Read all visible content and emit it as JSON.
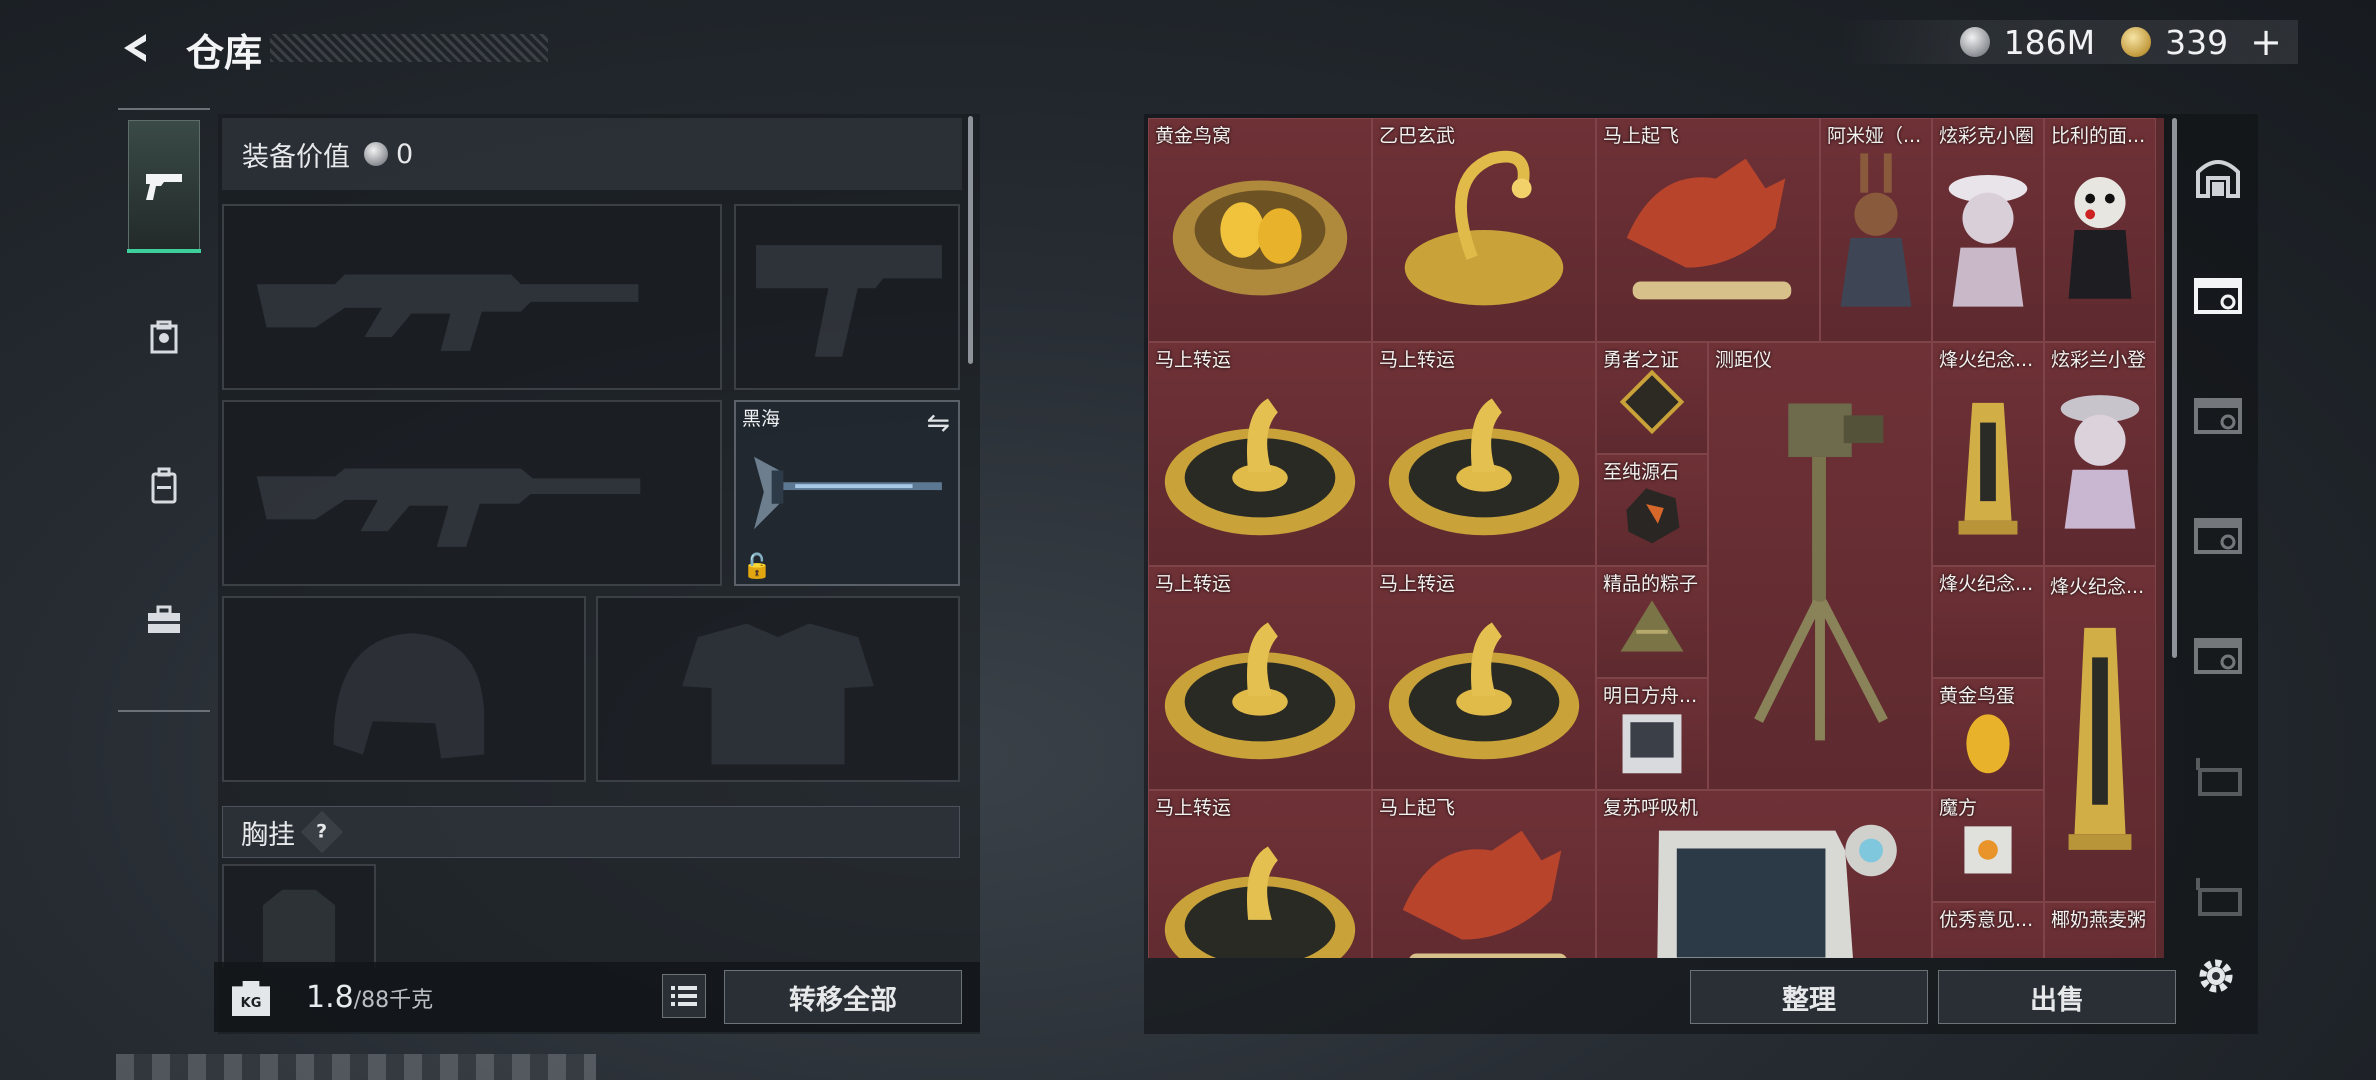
{
  "header": {
    "title": "仓库",
    "currency_silver": "186M",
    "currency_gold": "339",
    "plus": "+"
  },
  "left_nav": [
    {
      "icon": "pistol-icon",
      "active": true
    },
    {
      "icon": "armor-icon",
      "active": false
    },
    {
      "icon": "backpack-icon",
      "active": false
    },
    {
      "icon": "toolbox-icon",
      "active": false
    }
  ],
  "equipment": {
    "value_label": "装备价值",
    "value": "0",
    "melee_name": "黑海",
    "chest_label": "胸挂",
    "chest_help": "?"
  },
  "bottom": {
    "weight_current": "1.8",
    "weight_max": "/88千克",
    "kg_label": "KG",
    "transfer_all": "转移全部"
  },
  "storage": {
    "items": [
      {
        "name": "黄金鸟窝",
        "icon": "golden-nest"
      },
      {
        "name": "乙巴玄武",
        "icon": "golden-turtle"
      },
      {
        "name": "马上起飞",
        "icon": "red-horse"
      },
      {
        "name": "阿米娅（...",
        "icon": "figure-girl"
      },
      {
        "name": "炫彩克小圈",
        "icon": "figure-hat"
      },
      {
        "name": "比利的面...",
        "icon": "puppet-mask"
      },
      {
        "name": "马上转运",
        "icon": "fortune-disc"
      },
      {
        "name": "马上转运",
        "icon": "fortune-disc"
      },
      {
        "name": "勇者之证",
        "icon": "badge"
      },
      {
        "name": "测距仪",
        "icon": "tripod-rangefinder"
      },
      {
        "name": "烽火纪念...",
        "icon": "trophy-pillar"
      },
      {
        "name": "炫彩兰小登",
        "icon": "figure-hat"
      },
      {
        "name": "至纯源石",
        "icon": "ore"
      },
      {
        "name": "马上转运",
        "icon": "fortune-disc"
      },
      {
        "name": "马上转运",
        "icon": "fortune-disc"
      },
      {
        "name": "精品的粽子",
        "icon": "zongzi"
      },
      {
        "name": "烽火纪念...",
        "icon": "trophy-pillar"
      },
      {
        "name": "明日方舟...",
        "icon": "album"
      },
      {
        "name": "黄金鸟蛋",
        "icon": "golden-egg"
      },
      {
        "name": "马上转运",
        "icon": "fortune-disc"
      },
      {
        "name": "马上起飞",
        "icon": "red-horse"
      },
      {
        "name": "复苏呼吸机",
        "icon": "ventilator"
      },
      {
        "name": "魔方",
        "icon": "cube"
      },
      {
        "name": "优秀意见...",
        "icon": "card"
      },
      {
        "name": "椰奶燕麦粥",
        "icon": "drink"
      }
    ]
  },
  "actions": {
    "sort": "整理",
    "sell": "出售"
  },
  "colors": {
    "accent": "#3ecf9a",
    "item_bg": "#6e3136",
    "panel": "#2a2f35"
  }
}
